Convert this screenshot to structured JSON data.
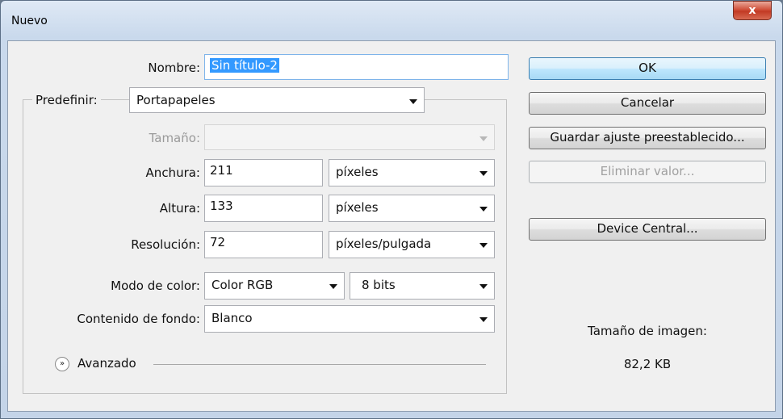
{
  "window": {
    "title": "Nuevo",
    "close_symbol": "x"
  },
  "form": {
    "nombre": {
      "label": "Nombre:",
      "value": "Sin título-2"
    },
    "predefinir": {
      "label": "Predefinir:",
      "value": "Portapapeles"
    },
    "tamano": {
      "label": "Tamaño:",
      "value": ""
    },
    "anchura": {
      "label": "Anchura:",
      "value": "211",
      "unit": "píxeles"
    },
    "altura": {
      "label": "Altura:",
      "value": "133",
      "unit": "píxeles"
    },
    "resolucion": {
      "label": "Resolución:",
      "value": "72",
      "unit": "píxeles/pulgada"
    },
    "modo_color": {
      "label": "Modo de color:",
      "value": "Color RGB",
      "bits": "8 bits"
    },
    "contenido_fondo": {
      "label": "Contenido de fondo:",
      "value": "Blanco"
    },
    "avanzado": {
      "label": "Avanzado",
      "icon": "double-chevron-down-icon"
    }
  },
  "buttons": {
    "ok": "OK",
    "cancelar": "Cancelar",
    "guardar": "Guardar ajuste preestablecido...",
    "eliminar": "Eliminar valor...",
    "device_central": "Device Central..."
  },
  "image_size": {
    "label": "Tamaño de imagen:",
    "value": "82,2 KB"
  },
  "colors": {
    "default_button": "#bee6fd",
    "selection": "#3399ff",
    "close_button": "#c23a24"
  }
}
